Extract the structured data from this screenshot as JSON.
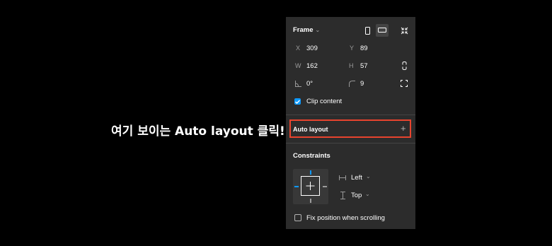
{
  "caption": "여기 보이는 Auto layout 클릭!",
  "panel": {
    "frame": {
      "title": "Frame",
      "x_label": "X",
      "x_value": "309",
      "y_label": "Y",
      "y_value": "89",
      "w_label": "W",
      "w_value": "162",
      "h_label": "H",
      "h_value": "57",
      "rotation_value": "0°",
      "radius_value": "9",
      "clip_content_label": "Clip content",
      "clip_content_checked": true
    },
    "auto_layout": {
      "label": "Auto layout",
      "add_icon": "+"
    },
    "constraints": {
      "title": "Constraints",
      "horizontal_value": "Left",
      "vertical_value": "Top",
      "fix_position_label": "Fix position when scrolling",
      "fix_position_checked": false
    }
  },
  "colors": {
    "background": "#000000",
    "panel": "#2c2c2c",
    "highlight": "#e8442e",
    "accent": "#0d99ff"
  }
}
